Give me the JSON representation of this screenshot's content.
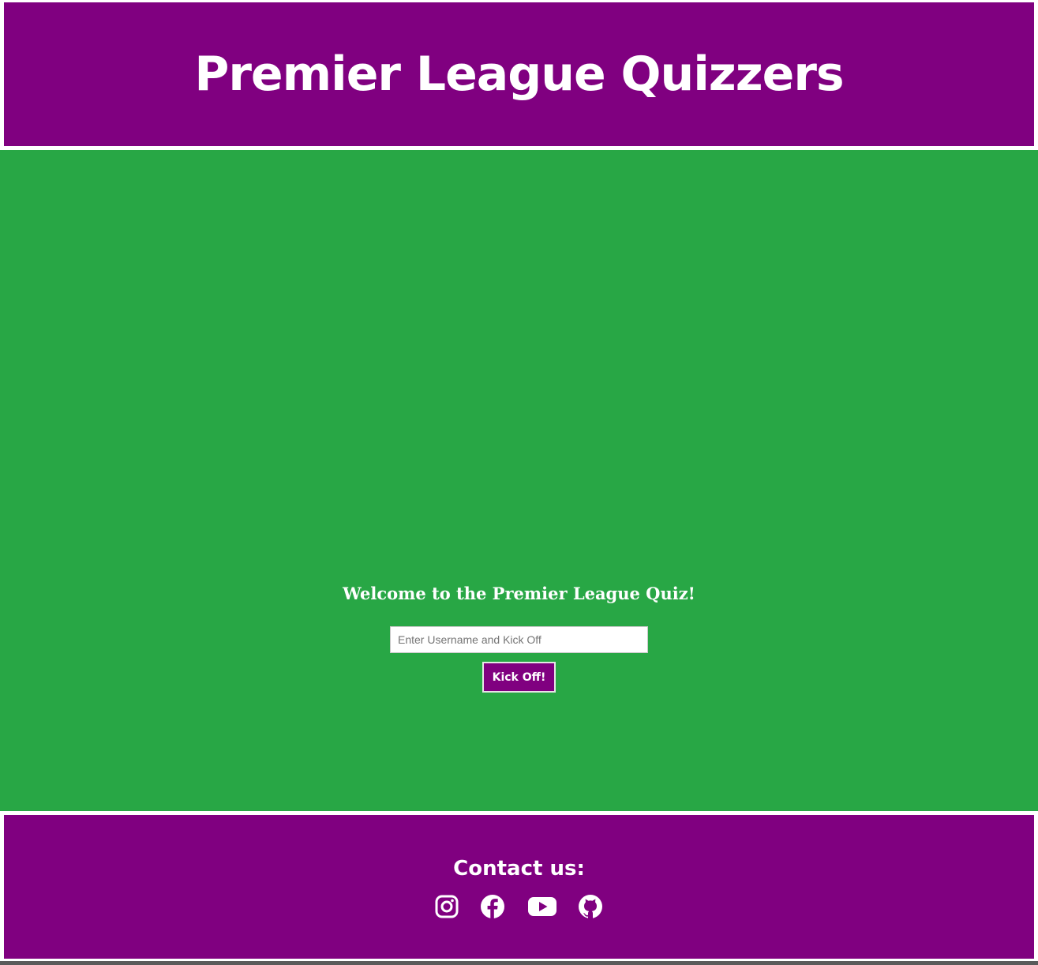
{
  "header": {
    "title": "Premier League Quizzers"
  },
  "main": {
    "welcome_heading": "Welcome to the Premier League Quiz!",
    "username_input": {
      "placeholder": "Enter Username and Kick Off",
      "value": ""
    },
    "kick_off_button": "Kick Off!"
  },
  "footer": {
    "contact_heading": "Contact us:",
    "social_links": [
      {
        "icon": "instagram-icon",
        "title": "Instagram"
      },
      {
        "icon": "facebook-icon",
        "title": "Facebook"
      },
      {
        "icon": "youtube-icon",
        "title": "YouTube"
      },
      {
        "icon": "github-icon",
        "title": "GitHub"
      }
    ]
  },
  "colors": {
    "brand_purple": "#800080",
    "pitch_green": "#28a745",
    "text_white": "#ffffff"
  }
}
